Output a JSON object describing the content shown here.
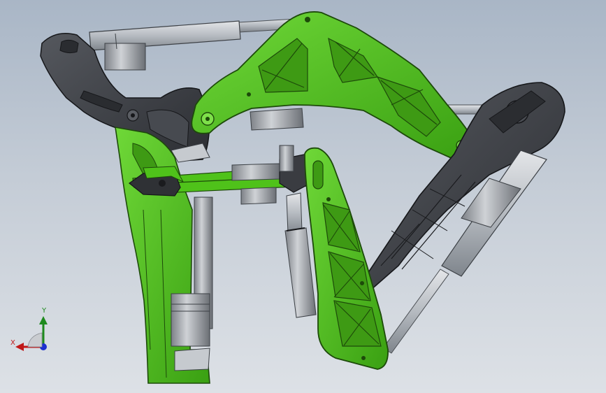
{
  "viewport": {
    "background_top": "#a9b6c6",
    "background_bottom": "#dde1e6"
  },
  "model": {
    "colors": {
      "green_part": "#4fc21a",
      "green_edge": "#1d4a0a",
      "dark_part": "#3b3d42",
      "dark_edge": "#16171a",
      "rod": "#b9bec4",
      "actuator_body": "#a6aab0"
    }
  },
  "triad": {
    "x_label": "X",
    "y_label": "Y",
    "x_color": "#c01818",
    "y_color": "#1e8a1e",
    "z_color": "#1d2fd0"
  }
}
